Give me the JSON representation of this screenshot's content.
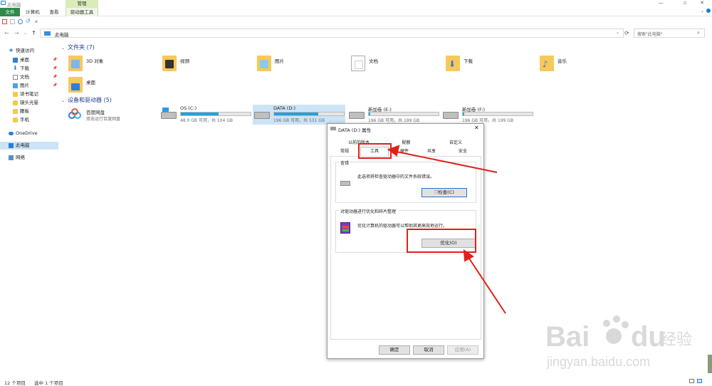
{
  "window": {
    "title": "此电脑",
    "management_tab": "管理"
  },
  "ribbon": {
    "tabs": [
      "文件",
      "计算机",
      "查看",
      "驱动器工具"
    ]
  },
  "address": {
    "path": "此电脑",
    "search_placeholder": "搜索\"此电脑\""
  },
  "sidebar": {
    "quick_access": "快速访问",
    "items": [
      "桌面",
      "下载",
      "文档",
      "图片",
      "读书笔记",
      "镜头光晕",
      "腰板",
      "手机"
    ],
    "onedrive": "OneDrive",
    "this_pc": "此电脑",
    "network": "网络"
  },
  "folders": {
    "header": "文件夹 (7)",
    "items": [
      "3D 对象",
      "视频",
      "图片",
      "文档",
      "下载",
      "音乐",
      "桌面"
    ]
  },
  "devices": {
    "header": "设备和驱动器 (5)",
    "baidu": {
      "name": "百度网盘",
      "subtitle": "双击运行百度网盘"
    },
    "drives": [
      {
        "name": "OS (C:)",
        "size": "48.0 GB 可用，共 104 GB",
        "used_fraction": 0.54
      },
      {
        "name": "DATA (D:)",
        "size": "196 GB 可用，共 531 GB",
        "used_fraction": 0.63
      },
      {
        "name": "新加卷 (E:)",
        "size": "196 GB 可用，共 199 GB",
        "used_fraction": 0.02
      },
      {
        "name": "新加卷 (F:)",
        "size": "196 GB 可用，共 199 GB",
        "used_fraction": 0.02
      }
    ]
  },
  "status": {
    "count": "12 个项目",
    "selected": "选中 1 个项目"
  },
  "dialog": {
    "title": "DATA (D:) 属性",
    "tabs_row1": [
      "以前的版本",
      "配额",
      "自定义"
    ],
    "tabs_row2": [
      "常规",
      "工具",
      "硬件",
      "共享",
      "安全"
    ],
    "check_section": "查错",
    "check_text": "此选项将检查驱动器中的文件系统错误。",
    "check_button": "检查(C)",
    "optimize_section": "对驱动器进行优化和碎片整理",
    "optimize_text": "优化计算机的驱动器可以帮助其更高效地运行。",
    "optimize_button": "优化(O)",
    "ok": "确定",
    "cancel": "取消",
    "apply": "应用(A)"
  },
  "colors": {
    "accent": "#26a0da",
    "selection": "#cce4f7",
    "annotation": "#e0201a",
    "file_tab": "#2f8a4b"
  }
}
